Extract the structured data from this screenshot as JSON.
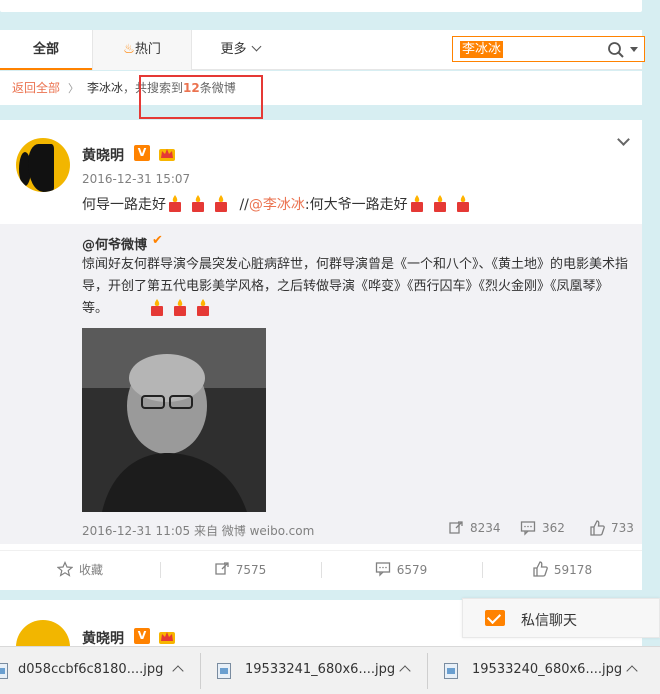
{
  "tabs": {
    "all": "全部",
    "hot": "热门",
    "more": "更多"
  },
  "search": {
    "value": "李冰冰"
  },
  "breadcrumb": {
    "back": "返回全部",
    "term": "李冰冰",
    "prefix": "，共搜索到",
    "count": "12",
    "suffix": "条微博"
  },
  "post": {
    "author": "黄晓明",
    "verified_badge": "V",
    "time": "2016-12-31 15:07",
    "text_start": "何导一路走好",
    "repost_sep": " //",
    "mention": "@李冰冰",
    "text_end": ":何大爷一路走好",
    "quoted": {
      "author": "@何爷微博",
      "body": "惊闻好友何群导演今晨突发心脏病辞世，何群导演曾是《一个和八个》、《黄土地》的电影美术指导，开创了第五代电影美学风格，之后转做导演《哗变》《西行囚车》《烈火金刚》《凤凰琴》等。",
      "meta": "2016-12-31 11:05 来自 微博 weibo.com",
      "repost_count": "8234",
      "comment_count": "362",
      "like_count": "733"
    },
    "actions": {
      "favorite": "收藏",
      "repost": "7575",
      "comment": "6579",
      "like": "59178"
    }
  },
  "post2": {
    "author": "黄晓明",
    "verified_badge": "V"
  },
  "chat": {
    "label": "私信聊天"
  },
  "downloads": [
    {
      "name": "d058ccbf6c8180....jpg"
    },
    {
      "name": "19533241_680x6....jpg"
    },
    {
      "name": "19533240_680x6....jpg"
    }
  ],
  "colors": {
    "accent": "#ff8200",
    "link": "#eb7350",
    "background": "#d7eef2"
  }
}
